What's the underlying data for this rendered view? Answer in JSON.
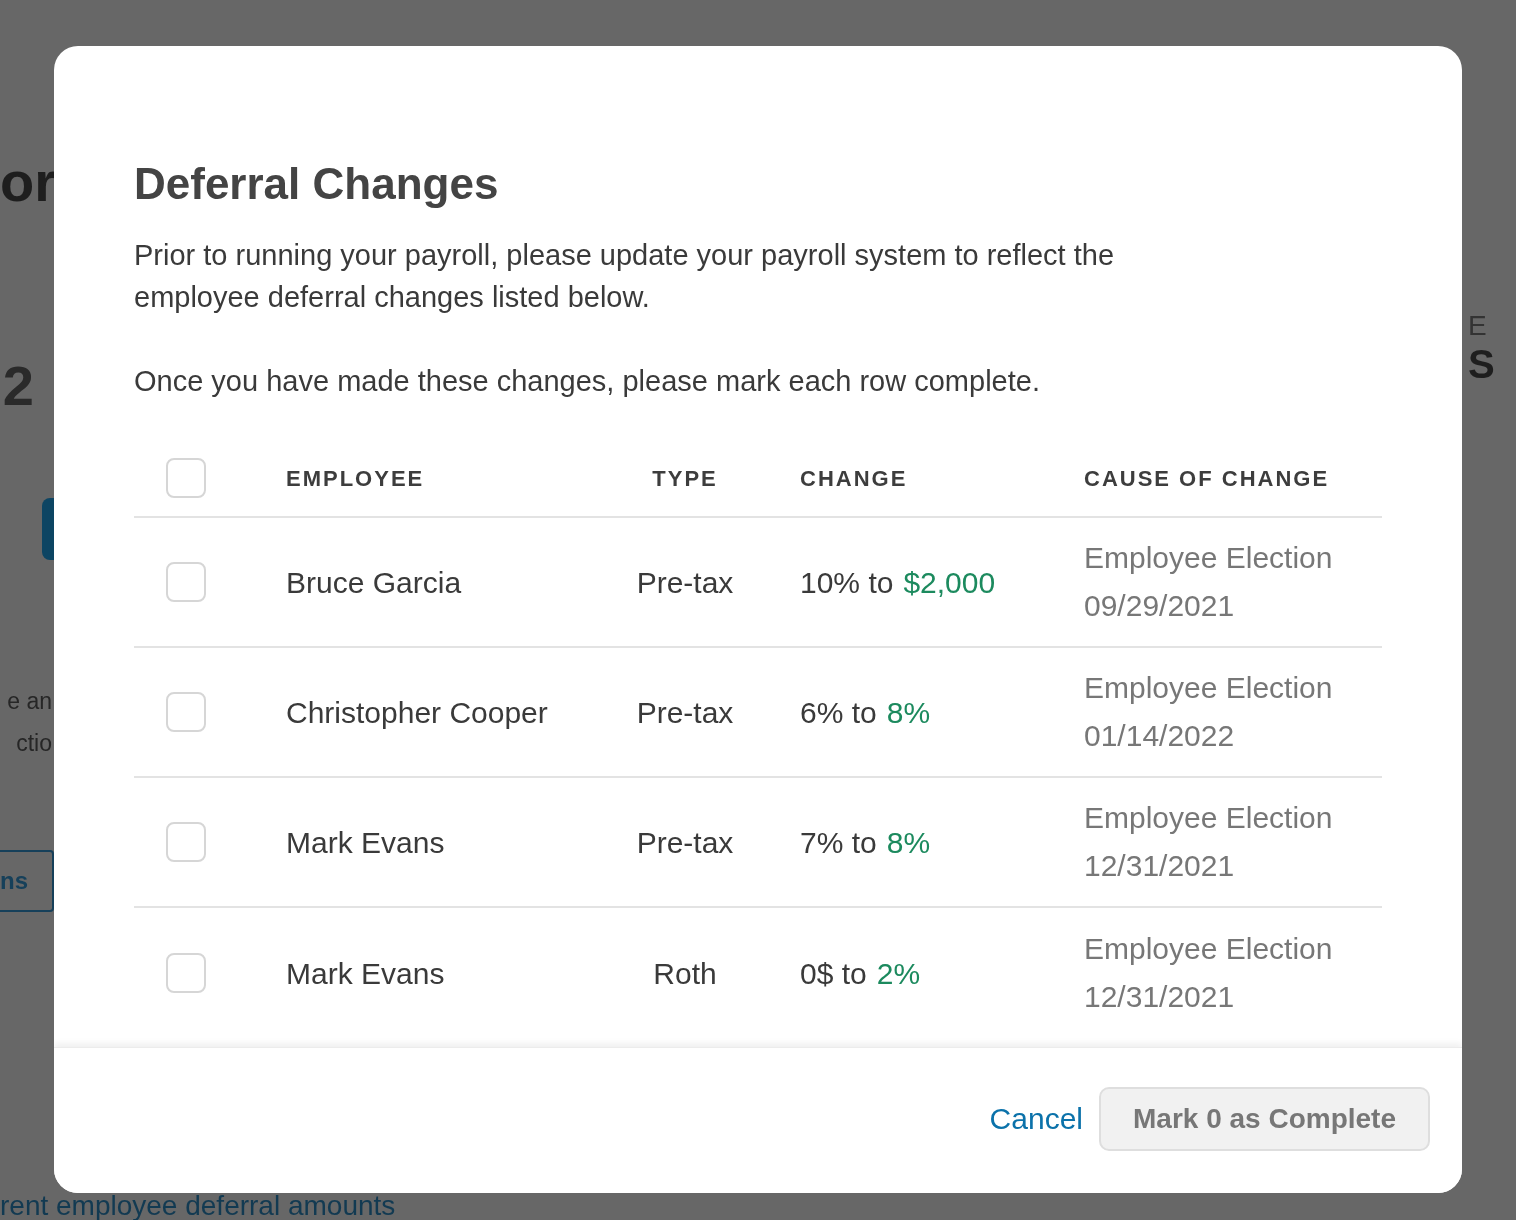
{
  "background_page": {
    "left_fragments": [
      {
        "kind": "heading",
        "text": "or"
      },
      {
        "kind": "number",
        "text": "2"
      },
      {
        "kind": "button"
      },
      {
        "kind": "text",
        "text": "e an"
      },
      {
        "kind": "text",
        "text": "ctio"
      },
      {
        "kind": "outline_button",
        "text": "ns"
      }
    ],
    "right_fragments": [
      {
        "kind": "label",
        "text": "E"
      },
      {
        "kind": "heading",
        "text": "S"
      }
    ],
    "bottom_link": "rent employee deferral amounts"
  },
  "modal": {
    "title": "Deferral Changes",
    "paragraphs": [
      "Prior to running your payroll, please update your payroll system to reflect the employee deferral changes listed below.",
      "Once you have made these changes, please mark each row complete."
    ],
    "table": {
      "select_all": {
        "checked": false
      },
      "columns": [
        "EMPLOYEE",
        "TYPE",
        "CHANGE",
        "CAUSE OF CHANGE"
      ],
      "rows": [
        {
          "checked": false,
          "employee": "Bruce Garcia",
          "type": "Pre-tax",
          "change_from": "10% to",
          "change_to": "$2,000",
          "cause": "Employee Election",
          "date": "09/29/2021"
        },
        {
          "checked": false,
          "employee": "Christopher Cooper",
          "type": "Pre-tax",
          "change_from": "6% to",
          "change_to": "8%",
          "cause": "Employee Election",
          "date": "01/14/2022"
        },
        {
          "checked": false,
          "employee": "Mark Evans",
          "type": "Pre-tax",
          "change_from": "7% to",
          "change_to": "8%",
          "cause": "Employee Election",
          "date": "12/31/2021"
        },
        {
          "checked": false,
          "employee": "Mark Evans",
          "type": "Roth",
          "change_from": "0$ to",
          "change_to": "2%",
          "cause": "Employee Election",
          "date": "12/31/2021"
        }
      ]
    },
    "footer": {
      "cancel": "Cancel",
      "complete_button": {
        "label": "Mark 0 as Complete",
        "disabled": true
      }
    }
  }
}
